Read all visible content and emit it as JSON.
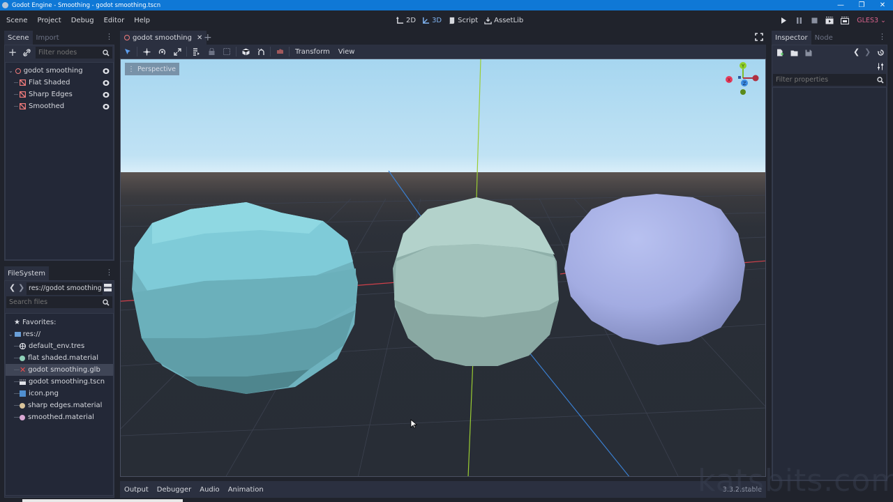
{
  "window": {
    "title": "Godot Engine - Smoothing - godot smoothing.tscn",
    "controls": [
      "minimize-icon",
      "maximize-icon",
      "close-icon"
    ]
  },
  "menu": {
    "items": [
      "Scene",
      "Project",
      "Debug",
      "Editor",
      "Help"
    ]
  },
  "main_screens": [
    {
      "label": "2D",
      "icon": "2d-icon",
      "active": false
    },
    {
      "label": "3D",
      "icon": "3d-icon",
      "active": true
    },
    {
      "label": "Script",
      "icon": "script-icon",
      "active": false
    },
    {
      "label": "AssetLib",
      "icon": "assetlib-icon",
      "active": false
    }
  ],
  "run_controls": {
    "buttons": [
      "play-icon",
      "pause-icon",
      "stop-icon",
      "play-scene-icon",
      "play-custom-scene-icon"
    ],
    "renderer": "GLES3"
  },
  "scene_dock": {
    "tabs": [
      "Scene",
      "Import"
    ],
    "active_tab": "Scene",
    "filter_placeholder": "Filter nodes",
    "nodes": [
      {
        "label": "godot smoothing",
        "icon": "spatial-node-icon",
        "depth": 0,
        "expanded": true,
        "visible": true
      },
      {
        "label": "Flat Shaded",
        "icon": "mesh-instance-icon",
        "depth": 1,
        "visible": true
      },
      {
        "label": "Sharp Edges",
        "icon": "mesh-instance-icon",
        "depth": 1,
        "visible": true
      },
      {
        "label": "Smoothed",
        "icon": "mesh-instance-icon",
        "depth": 1,
        "visible": true
      }
    ]
  },
  "filesystem_dock": {
    "tab": "FileSystem",
    "path": "res://godot smoothing",
    "search_placeholder": "Search files",
    "favorites_label": "Favorites:",
    "root_label": "res://",
    "files": [
      {
        "name": "default_env.tres",
        "icon": "environment-icon",
        "selected": false
      },
      {
        "name": "flat shaded.material",
        "icon": "material-icon",
        "color": "#8fd0b8",
        "selected": false
      },
      {
        "name": "godot smoothing.glb",
        "icon": "broken-import-icon",
        "selected": true
      },
      {
        "name": "godot smoothing.tscn",
        "icon": "scene-file-icon",
        "selected": false
      },
      {
        "name": "icon.png",
        "icon": "image-icon",
        "selected": false
      },
      {
        "name": "sharp edges.material",
        "icon": "material-icon",
        "color": "#d8c39a",
        "selected": false
      },
      {
        "name": "smoothed.material",
        "icon": "material-icon",
        "color": "#d9a8d4",
        "selected": false
      }
    ]
  },
  "editor": {
    "scene_tab": "godot smoothing",
    "toolbar_menus": [
      "Transform",
      "View"
    ],
    "viewport_label": "Perspective",
    "gizmo_axes": [
      "X",
      "Y",
      "Z"
    ]
  },
  "bottom_panel": {
    "tabs": [
      "Output",
      "Debugger",
      "Audio",
      "Animation"
    ],
    "version": "3.3.2.stable"
  },
  "watermark": "katsbits.com",
  "inspector_dock": {
    "tabs": [
      "Inspector",
      "Node"
    ],
    "active_tab": "Inspector",
    "filter_placeholder": "Filter properties"
  },
  "colors": {
    "accent": "#7fb2ef",
    "titlebar": "#0f78d6",
    "renderer": "#d8638c",
    "sphere_flat": "#7fcfdc",
    "sphere_sharp": "#a9c9c2",
    "sphere_smooth": "#a5b0e6"
  }
}
